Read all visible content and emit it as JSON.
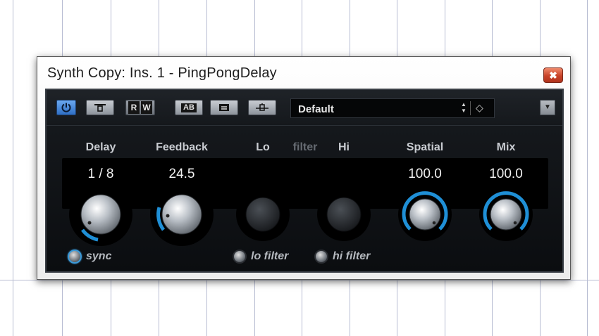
{
  "window": {
    "title": "Synth Copy: Ins. 1 - PingPongDelay",
    "close_glyph": "✖"
  },
  "toolbar": {
    "power_icon": "power-icon",
    "bypass_icon": "bypass-icon",
    "read_label": "R",
    "write_label": "W",
    "ab_label": "AB",
    "list_icon": "list-icon",
    "routing_icon": "routing-icon",
    "preset_name": "Default",
    "menu_icon": "triangle-down-icon"
  },
  "params": {
    "delay": {
      "label": "Delay",
      "value": "1 / 8",
      "switch_label": "sync",
      "switch_on": true
    },
    "feedback": {
      "label": "Feedback",
      "value": "24.5"
    },
    "lo": {
      "label": "Lo",
      "switch_label": "lo filter",
      "switch_on": false
    },
    "filter_label": "filter",
    "hi": {
      "label": "Hi",
      "switch_label": "hi filter",
      "switch_on": false
    },
    "spatial": {
      "label": "Spatial",
      "value": "100.0"
    },
    "mix": {
      "label": "Mix",
      "value": "100.0"
    }
  },
  "colors": {
    "accent": "#1f8fd6",
    "panel_bg": "#0d0f12",
    "title_text": "#1d1d1d",
    "close_red": "#c8432a"
  }
}
